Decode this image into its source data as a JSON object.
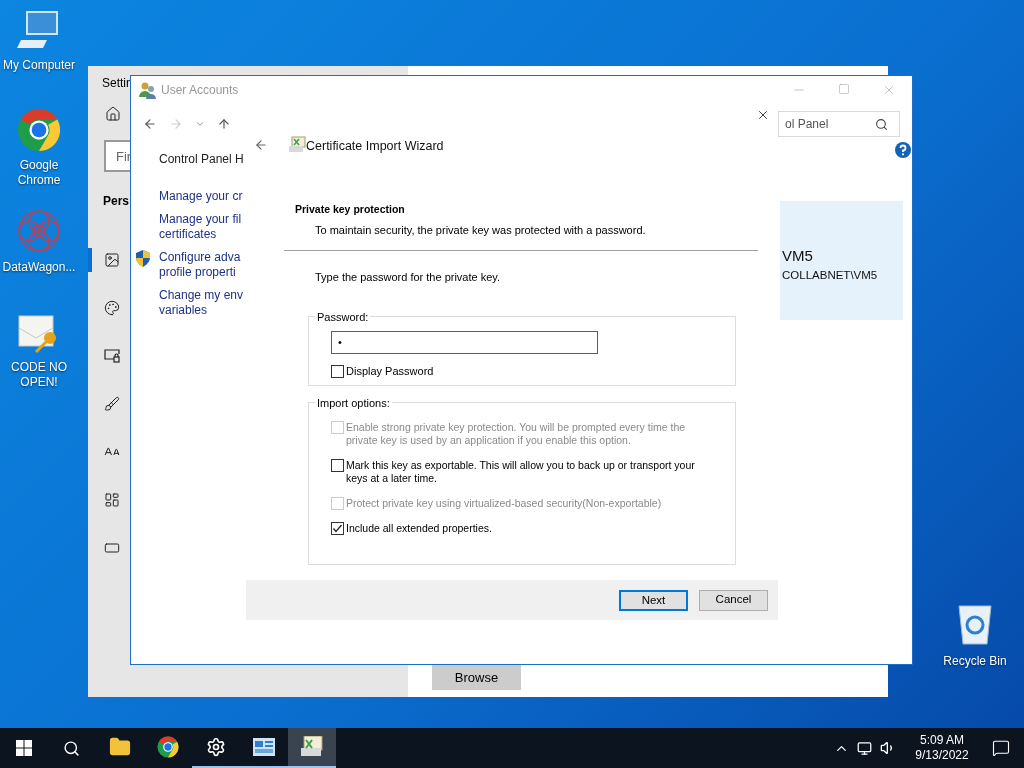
{
  "desktop_icons": [
    {
      "kind": "computer",
      "label": "My Computer"
    },
    {
      "kind": "chrome",
      "label": "Google Chrome"
    },
    {
      "kind": "datawagon",
      "label": "DataWagon..."
    },
    {
      "kind": "mail-key",
      "label": "CODE NO OPEN!"
    }
  ],
  "recycle_bin": {
    "label": "Recycle Bin"
  },
  "settings_window": {
    "title": "Settin",
    "search": {
      "placeholder": "Fir"
    },
    "heading": "Pers",
    "nav": [
      {
        "kind": "background",
        "selected": true
      },
      {
        "kind": "colors",
        "selected": false
      },
      {
        "kind": "lock-screen",
        "selected": false
      },
      {
        "kind": "themes",
        "selected": false
      },
      {
        "kind": "fonts",
        "selected": false
      },
      {
        "kind": "start",
        "selected": false
      },
      {
        "kind": "taskbar",
        "selected": false
      }
    ],
    "browse_button": "Browse"
  },
  "user_accounts_window": {
    "title": "User Accounts",
    "search": {
      "placeholder": "ol Panel"
    },
    "links": [
      {
        "lines": [
          "Control Panel H"
        ],
        "shield": false,
        "heading": true
      },
      {
        "lines": [
          "Manage your cr"
        ],
        "shield": false,
        "heading": false
      },
      {
        "lines": [
          "Manage your fil",
          "certificates"
        ],
        "shield": false,
        "heading": false
      },
      {
        "lines": [
          "Configure adva",
          "profile properti"
        ],
        "shield": true,
        "heading": false
      },
      {
        "lines": [
          "Change my env",
          "variables"
        ],
        "shield": false,
        "heading": false
      }
    ],
    "account": {
      "name": "VM5",
      "domain": "COLLABNET\\VM5"
    }
  },
  "wizard": {
    "title": "Certificate Import Wizard",
    "section_title": "Private key protection",
    "section_subtitle": "To maintain security, the private key was protected with a password.",
    "instruction": "Type the password for the private key.",
    "password_group": {
      "label": "Password:",
      "value": "•",
      "display_password": {
        "label": "Display Password",
        "checked": false
      }
    },
    "import_options": {
      "label": "Import options:",
      "options": [
        {
          "lines": [
            "Enable strong private key protection. You will be prompted every time the",
            "private key is used by an application if you enable this option."
          ],
          "checked": false,
          "disabled": true
        },
        {
          "lines": [
            "Mark this key as exportable. This will allow you to back up or transport your",
            "keys at a later time."
          ],
          "checked": false,
          "disabled": false
        },
        {
          "lines": [
            "Protect private key using virtualized-based security(Non-exportable)"
          ],
          "checked": false,
          "disabled": true
        },
        {
          "lines": [
            "Include all extended properties."
          ],
          "checked": true,
          "disabled": false
        }
      ]
    },
    "buttons": [
      {
        "label": "Next",
        "default": true
      },
      {
        "label": "Cancel",
        "default": false
      }
    ]
  },
  "taskbar": {
    "apps": [
      {
        "kind": "folder",
        "running": false,
        "active": false
      },
      {
        "kind": "chrome",
        "running": false,
        "active": false
      },
      {
        "kind": "settings",
        "running": true,
        "active": false
      },
      {
        "kind": "control-panel",
        "running": true,
        "active": false
      },
      {
        "kind": "certificate",
        "running": true,
        "active": true
      }
    ],
    "time": "5:09 AM",
    "date": "9/13/2022"
  }
}
